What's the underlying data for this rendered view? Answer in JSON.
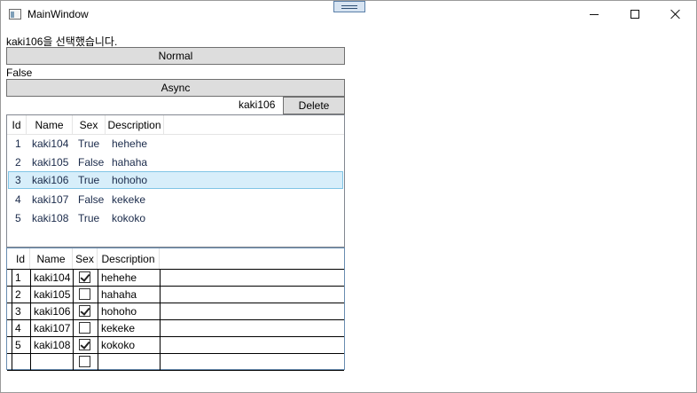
{
  "window": {
    "title": "MainWindow"
  },
  "status": {
    "message": "kaki106을 선택했습니다."
  },
  "buttons": {
    "normal": "Normal",
    "async": "Async",
    "delete": "Delete"
  },
  "flag": {
    "value": "False"
  },
  "selection": {
    "name": "kaki106"
  },
  "listview": {
    "columns": [
      "Id",
      "Name",
      "Sex",
      "Description"
    ],
    "rows": [
      {
        "id": "1",
        "name": "kaki104",
        "sex": "True",
        "description": "hehehe"
      },
      {
        "id": "2",
        "name": "kaki105",
        "sex": "False",
        "description": "hahaha"
      },
      {
        "id": "3",
        "name": "kaki106",
        "sex": "True",
        "description": "hohoho"
      },
      {
        "id": "4",
        "name": "kaki107",
        "sex": "False",
        "description": "kekeke"
      },
      {
        "id": "5",
        "name": "kaki108",
        "sex": "True",
        "description": "kokoko"
      }
    ],
    "selected_index": 2
  },
  "datagrid": {
    "columns": [
      "Id",
      "Name",
      "Sex",
      "Description"
    ],
    "rows": [
      {
        "id": "1",
        "name": "kaki104",
        "sex": true,
        "description": "hehehe"
      },
      {
        "id": "2",
        "name": "kaki105",
        "sex": false,
        "description": "hahaha"
      },
      {
        "id": "3",
        "name": "kaki106",
        "sex": true,
        "description": "hohoho"
      },
      {
        "id": "4",
        "name": "kaki107",
        "sex": false,
        "description": "kekeke"
      },
      {
        "id": "5",
        "name": "kaki108",
        "sex": true,
        "description": "kokoko"
      },
      {
        "id": "",
        "name": "",
        "sex": false,
        "description": ""
      }
    ]
  }
}
